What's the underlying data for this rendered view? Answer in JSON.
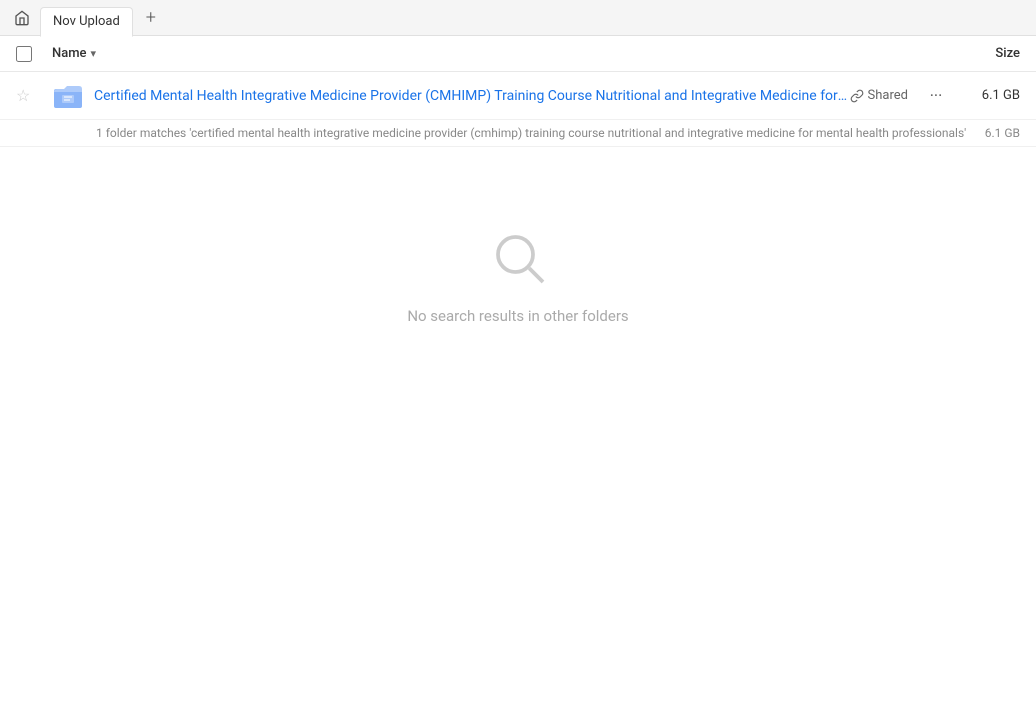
{
  "tabBar": {
    "homeIcon": "🏠",
    "activeTab": "Nov Upload",
    "addTabLabel": "+"
  },
  "tableHeader": {
    "nameLabel": "Name",
    "chevron": "▾",
    "sizeLabel": "Size"
  },
  "fileRow": {
    "fileName": "Certified Mental Health Integrative Medicine Provider (CMHIMP) Training Course Nutritional and Integrative Medicine for Mental H...",
    "sharedLabel": "Shared",
    "fileSize": "6.1 GB",
    "moreIcon": "···"
  },
  "matchRow": {
    "text": "1 folder matches 'certified mental health integrative medicine provider (cmhimp) training course nutritional and integrative medicine for mental health professionals'",
    "size": "6.1 GB"
  },
  "emptyState": {
    "text": "No search results in other folders",
    "searchIconUnicode": "🔍"
  },
  "colors": {
    "accent": "#1a73e8",
    "folderColor": "#5f9ea0",
    "sharedColor": "#666666"
  }
}
